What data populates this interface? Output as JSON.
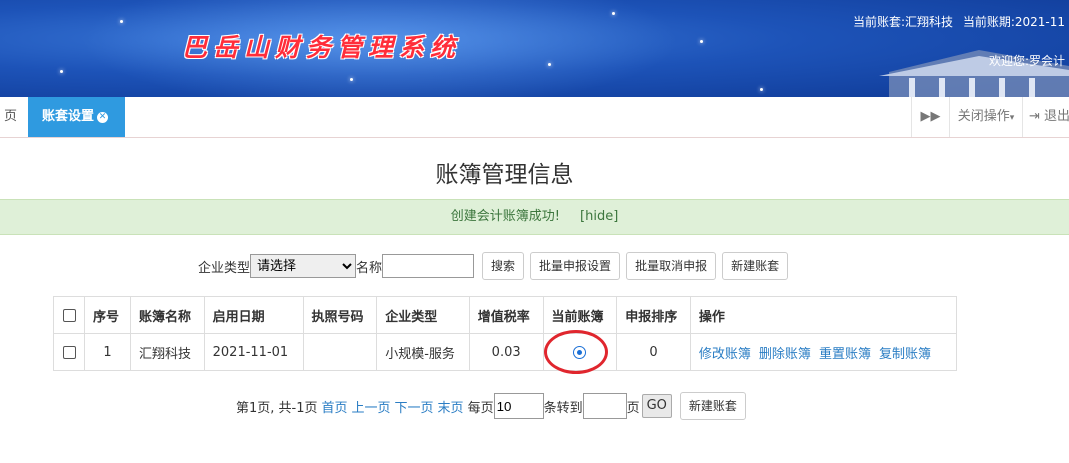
{
  "header": {
    "app_title": "巴岳山财务管理系统",
    "current_account": "当前账套:汇翔科技",
    "current_period": "当前账期:2021-11",
    "welcome": "欢迎您:罗会计"
  },
  "tabs": {
    "home_label": "页",
    "active_label": "账套设置",
    "close_ops_label": "关闭操作",
    "logout_label": "退出"
  },
  "page": {
    "title": "账簿管理信息",
    "alert_message": "创建会计账簿成功!",
    "alert_hide": "[hide]"
  },
  "filter": {
    "company_type_label": "企业类型",
    "company_type_value": "请选择",
    "name_label": "名称",
    "search_button": "搜索",
    "batch_declare_button": "批量申报设置",
    "batch_cancel_button": "批量取消申报",
    "new_book_button": "新建账套"
  },
  "table": {
    "headers": [
      "序号",
      "账簿名称",
      "启用日期",
      "执照号码",
      "企业类型",
      "增值税率",
      "当前账簿",
      "申报排序",
      "操作"
    ],
    "rows": [
      {
        "index": "1",
        "name": "汇翔科技",
        "start_date": "2021-11-01",
        "license": "",
        "company_type": "小规模-服务",
        "vat_rate": "0.03",
        "current": true,
        "declare_order": "0",
        "ops": [
          "修改账簿",
          "删除账簿",
          "重置账簿",
          "复制账簿"
        ]
      }
    ]
  },
  "pager": {
    "summary": "第1页, 共-1页",
    "first": "首页",
    "prev": "上一页",
    "next": "下一页",
    "last": "末页",
    "per_page_label": "每页",
    "per_page_value": "10",
    "goto_label": "条转到",
    "page_suffix": "页",
    "go_button": "GO",
    "new_book_button": "新建账套"
  },
  "colors": {
    "banner_blue": "#1d53b8",
    "tab_active": "#2f9ae0",
    "alert_bg": "#dff0d8",
    "link": "#2a7dc4",
    "highlight": "#e0262e"
  }
}
